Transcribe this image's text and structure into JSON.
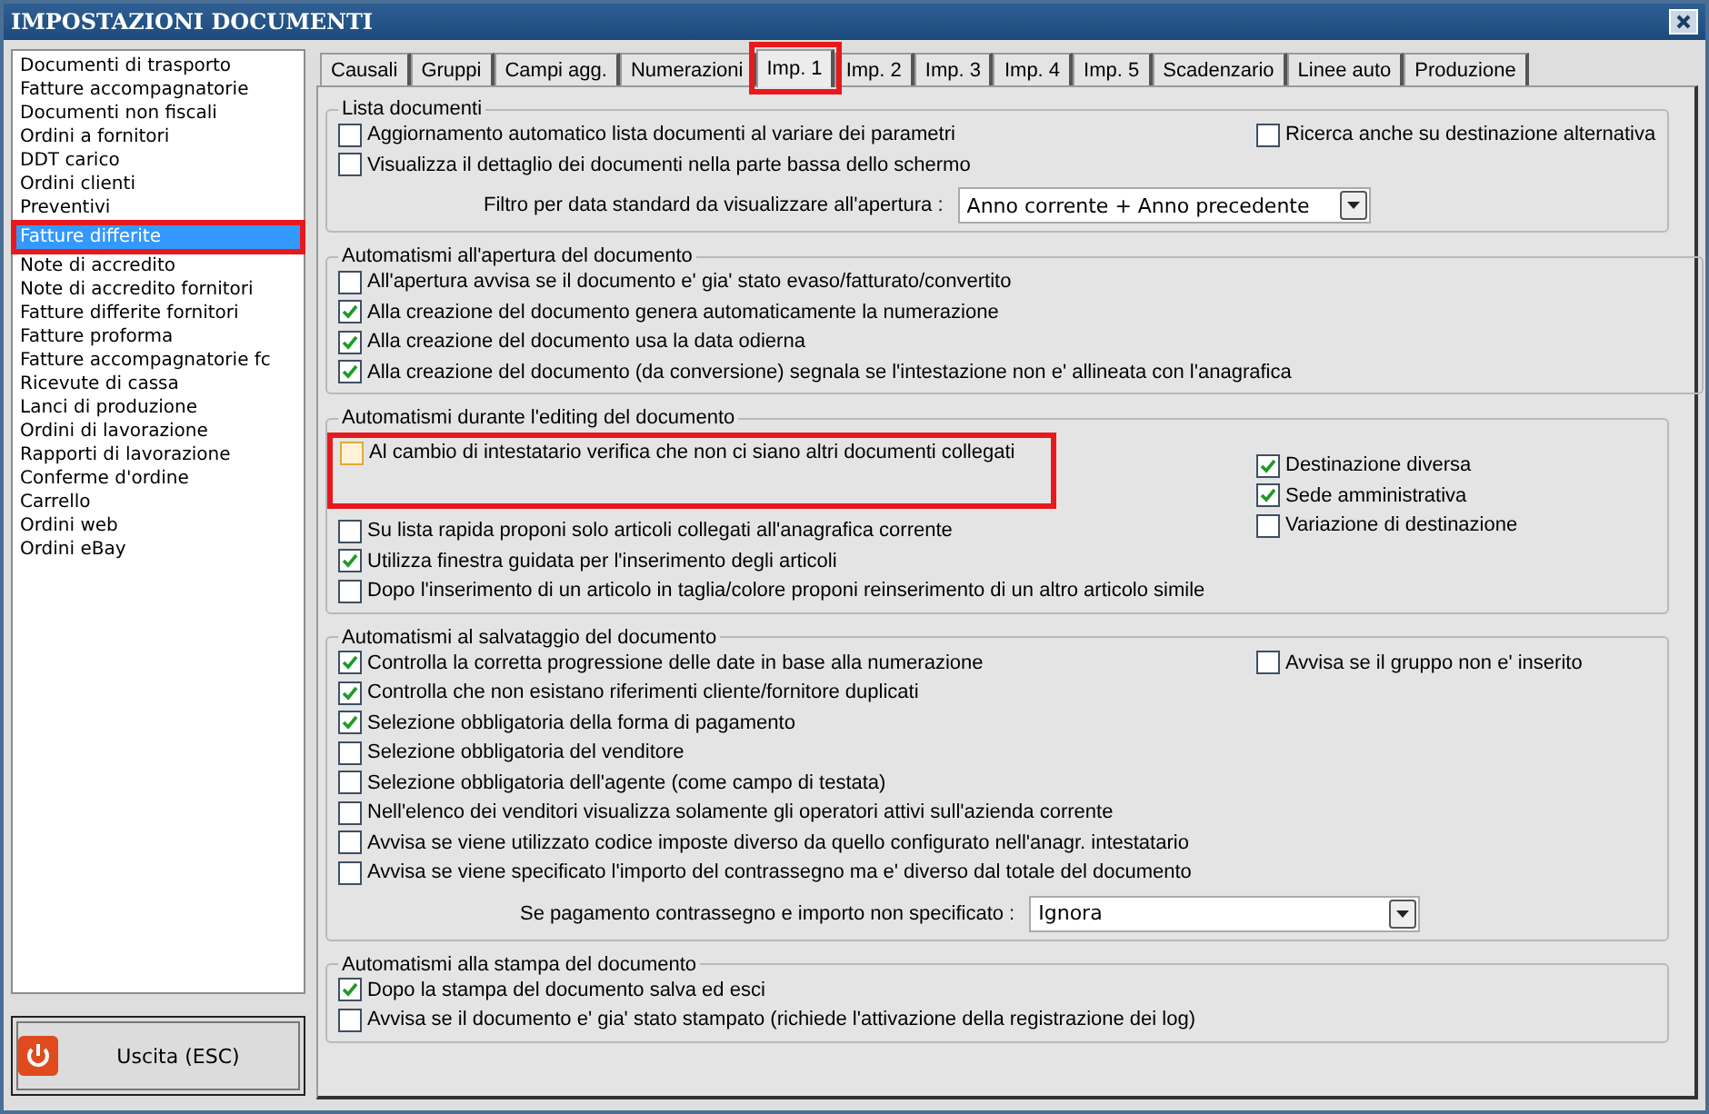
{
  "window": {
    "title": "IMPOSTAZIONI DOCUMENTI"
  },
  "sidebar": {
    "items": [
      {
        "label": "Documenti di trasporto",
        "selected": false,
        "highlighted": false
      },
      {
        "label": "Fatture accompagnatorie",
        "selected": false,
        "highlighted": false
      },
      {
        "label": "Documenti non fiscali",
        "selected": false,
        "highlighted": false
      },
      {
        "label": "Ordini a fornitori",
        "selected": false,
        "highlighted": false
      },
      {
        "label": "DDT carico",
        "selected": false,
        "highlighted": false
      },
      {
        "label": "Ordini clienti",
        "selected": false,
        "highlighted": false
      },
      {
        "label": "Preventivi",
        "selected": false,
        "highlighted": false
      },
      {
        "label": "Fatture differite",
        "selected": true,
        "highlighted": true
      },
      {
        "label": "Note di accredito",
        "selected": false,
        "highlighted": false
      },
      {
        "label": "Note di accredito fornitori",
        "selected": false,
        "highlighted": false
      },
      {
        "label": "Fatture differite fornitori",
        "selected": false,
        "highlighted": false
      },
      {
        "label": "Fatture proforma",
        "selected": false,
        "highlighted": false
      },
      {
        "label": "Fatture accompagnatorie fc",
        "selected": false,
        "highlighted": false
      },
      {
        "label": "Ricevute di cassa",
        "selected": false,
        "highlighted": false
      },
      {
        "label": "Lanci di produzione",
        "selected": false,
        "highlighted": false
      },
      {
        "label": "Ordini di lavorazione",
        "selected": false,
        "highlighted": false
      },
      {
        "label": "Rapporti di lavorazione",
        "selected": false,
        "highlighted": false
      },
      {
        "label": "Conferme d'ordine",
        "selected": false,
        "highlighted": false
      },
      {
        "label": "Carrello",
        "selected": false,
        "highlighted": false
      },
      {
        "label": "Ordini web",
        "selected": false,
        "highlighted": false
      },
      {
        "label": "Ordini eBay",
        "selected": false,
        "highlighted": false
      }
    ]
  },
  "exit_button": {
    "label": "Uscita (ESC)"
  },
  "tabs": [
    {
      "label": "Causali",
      "selected": false,
      "highlighted": false
    },
    {
      "label": "Gruppi",
      "selected": false,
      "highlighted": false
    },
    {
      "label": "Campi agg.",
      "selected": false,
      "highlighted": false
    },
    {
      "label": "Numerazioni",
      "selected": false,
      "highlighted": false
    },
    {
      "label": "Imp. 1",
      "selected": true,
      "highlighted": true
    },
    {
      "label": "Imp. 2",
      "selected": false,
      "highlighted": false
    },
    {
      "label": "Imp. 3",
      "selected": false,
      "highlighted": false
    },
    {
      "label": "Imp. 4",
      "selected": false,
      "highlighted": false
    },
    {
      "label": "Imp. 5",
      "selected": false,
      "highlighted": false
    },
    {
      "label": "Scadenzario",
      "selected": false,
      "highlighted": false
    },
    {
      "label": "Linee auto",
      "selected": false,
      "highlighted": false
    },
    {
      "label": "Produzione",
      "selected": false,
      "highlighted": false
    }
  ],
  "groups": [
    {
      "title": "Lista documenti",
      "left": [
        {
          "label": "Aggiornamento automatico lista documenti al variare dei parametri",
          "checked": false,
          "highlighted": false
        },
        {
          "label": "Visualizza il dettaglio dei documenti nella parte bassa dello schermo",
          "checked": false,
          "highlighted": false
        }
      ],
      "right": [
        {
          "label": "Ricerca anche su destinazione alternativa",
          "checked": false,
          "highlighted": false
        }
      ],
      "select": {
        "label": "Filtro per data standard da visualizzare all'apertura :",
        "value": "Anno corrente + Anno precedente"
      }
    },
    {
      "title": "Automatismi all'apertura del documento",
      "left": [
        {
          "label": "All'apertura avvisa se il documento e' gia' stato evaso/fatturato/convertito",
          "checked": false,
          "highlighted": false
        },
        {
          "label": "Alla creazione del documento genera automaticamente la numerazione",
          "checked": true,
          "highlighted": false
        },
        {
          "label": "Alla creazione del documento usa la data odierna",
          "checked": true,
          "highlighted": false
        },
        {
          "label": "Alla creazione del documento (da conversione) segnala se l'intestazione non e' allineata con l'anagrafica",
          "checked": true,
          "highlighted": false
        }
      ]
    },
    {
      "title": "Automatismi durante l'editing del documento",
      "left": [
        {
          "label": "Al cambio di intestatario verifica che non ci siano altri documenti collegati",
          "checked": false,
          "highlighted": true
        },
        {
          "label": "Su lista rapida proponi solo articoli collegati all'anagrafica corrente",
          "checked": false,
          "highlighted": false
        },
        {
          "label": "Utilizza finestra guidata per l'inserimento degli articoli",
          "checked": true,
          "highlighted": false
        },
        {
          "label": "Dopo l'inserimento di un articolo in taglia/colore proponi reinserimento di un altro articolo simile",
          "checked": false,
          "highlighted": false
        }
      ],
      "right": [
        {
          "label": "Destinazione diversa",
          "checked": true,
          "highlighted": false
        },
        {
          "label": "Sede amministrativa",
          "checked": true,
          "highlighted": false
        },
        {
          "label": "Variazione di destinazione",
          "checked": false,
          "highlighted": false
        }
      ]
    },
    {
      "title": "Automatismi al salvataggio del documento",
      "left": [
        {
          "label": "Controlla la corretta progressione delle date in base alla numerazione",
          "checked": true,
          "highlighted": false
        },
        {
          "label": "Controlla che non esistano riferimenti cliente/fornitore duplicati",
          "checked": true,
          "highlighted": false
        },
        {
          "label": "Selezione obbligatoria della forma di pagamento",
          "checked": true,
          "highlighted": false
        },
        {
          "label": "Selezione obbligatoria del venditore",
          "checked": false,
          "highlighted": false
        },
        {
          "label": "Selezione obbligatoria dell'agente (come campo di testata)",
          "checked": false,
          "highlighted": false
        },
        {
          "label": "Nell'elenco dei venditori visualizza solamente gli operatori attivi sull'azienda corrente",
          "checked": false,
          "highlighted": false
        },
        {
          "label": "Avvisa se viene utilizzato codice imposte diverso da quello configurato nell'anagr. intestatario",
          "checked": false,
          "highlighted": false
        },
        {
          "label": "Avvisa se viene specificato l'importo del contrassegno ma e' diverso dal totale del documento",
          "checked": false,
          "highlighted": false
        }
      ],
      "right": [
        {
          "label": "Avvisa se il gruppo non e' inserito",
          "checked": false,
          "highlighted": false
        }
      ],
      "select": {
        "label": "Se pagamento contrassegno e importo non specificato :",
        "value": "Ignora"
      }
    },
    {
      "title": "Automatismi alla stampa del documento",
      "left": [
        {
          "label": "Dopo la stampa del documento salva ed esci",
          "checked": true,
          "highlighted": false
        },
        {
          "label": "Avvisa se il documento e' gia' stato stampato (richiede l'attivazione della registrazione dei log)",
          "checked": false,
          "highlighted": false
        }
      ]
    }
  ]
}
